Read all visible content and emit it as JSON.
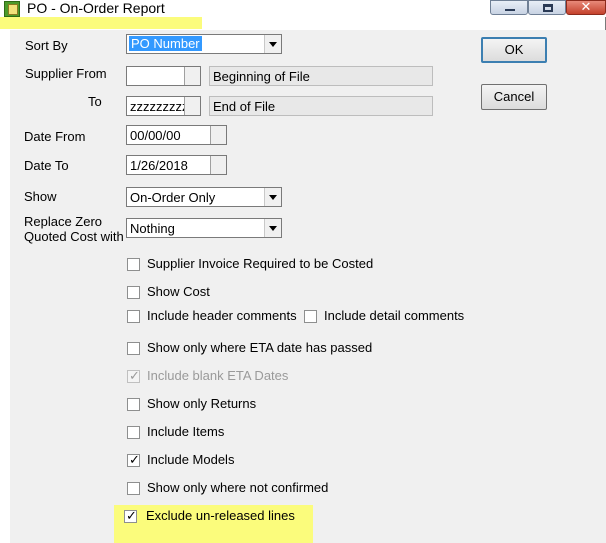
{
  "window": {
    "title": "PO - On-Order Report",
    "controls": {
      "minimize": "minimize",
      "maximize": "maximize",
      "close": "close"
    }
  },
  "form": {
    "sort_by": {
      "label": "Sort By",
      "value": "PO Number"
    },
    "supplier_from": {
      "label": "Supplier From",
      "value": "",
      "description": "Beginning of File"
    },
    "supplier_to": {
      "label": "To",
      "value": "zzzzzzzzzz",
      "description": "End of File"
    },
    "date_from": {
      "label": "Date From",
      "value": "00/00/00"
    },
    "date_to": {
      "label": "Date To",
      "value": "1/26/2018"
    },
    "show": {
      "label": "Show",
      "value": "On-Order Only"
    },
    "replace_zero": {
      "label_line1": "Replace Zero",
      "label_line2": "Quoted Cost with",
      "value": "Nothing"
    }
  },
  "buttons": {
    "ok": "OK",
    "cancel": "Cancel"
  },
  "checkboxes": [
    {
      "label": "Supplier Invoice Required to be Costed",
      "checked": false,
      "enabled": true
    },
    {
      "label": "Show Cost",
      "checked": false,
      "enabled": true
    },
    {
      "label": "Include header comments",
      "checked": false,
      "enabled": true
    },
    {
      "label": "Include detail comments",
      "checked": false,
      "enabled": true
    },
    {
      "label": "Show only where ETA date has passed",
      "checked": false,
      "enabled": true
    },
    {
      "label": "Include blank ETA Dates",
      "checked": true,
      "enabled": false
    },
    {
      "label": "Show only Returns",
      "checked": false,
      "enabled": true
    },
    {
      "label": "Include Items",
      "checked": false,
      "enabled": true
    },
    {
      "label": "Include Models",
      "checked": true,
      "enabled": true
    },
    {
      "label": "Show only where not confirmed",
      "checked": false,
      "enabled": true
    },
    {
      "label": "Exclude un-released  lines",
      "checked": true,
      "enabled": true
    }
  ],
  "colors": {
    "highlight": "#fbfc7c",
    "selection": "#3399ff"
  }
}
